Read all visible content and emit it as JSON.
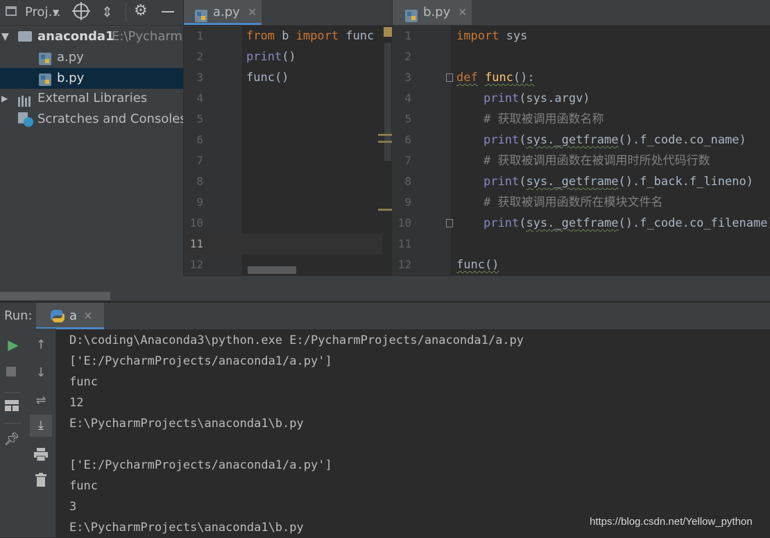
{
  "project_panel": {
    "title": "Proj…",
    "toolbar_icons": [
      "crosshair-icon",
      "collapse-icon",
      "gear-icon",
      "minimize-icon"
    ],
    "root": {
      "name": "anaconda1",
      "path": "E:\\PycharmP"
    },
    "files": [
      {
        "label": "a.py",
        "selected": false
      },
      {
        "label": "b.py",
        "selected": true
      }
    ],
    "external_libraries": "External Libraries",
    "scratches": "Scratches and Consoles"
  },
  "left_editor": {
    "tab": "a.py",
    "line_numbers": [
      "1",
      "2",
      "3",
      "4",
      "5",
      "6",
      "7",
      "8",
      "9",
      "10",
      "11",
      "12"
    ]
  },
  "right_editor": {
    "tab": "b.py",
    "line_numbers": [
      "1",
      "2",
      "3",
      "4",
      "5",
      "6",
      "7",
      "8",
      "9",
      "10",
      "11",
      "12"
    ]
  },
  "run": {
    "label": "Run:",
    "tab": "a",
    "output": [
      "D:\\coding\\Anaconda3\\python.exe E:/PycharmProjects/anaconda1/a.py",
      "['E:/PycharmProjects/anaconda1/a.py']",
      "func",
      "12",
      "E:\\PycharmProjects\\anaconda1\\b.py",
      "",
      "['E:/PycharmProjects/anaconda1/a.py']",
      "func",
      "3",
      "E:\\PycharmProjects\\anaconda1\\b.py"
    ]
  },
  "watermark": "https://blog.csdn.net/Yellow_python",
  "colors": {
    "keyword": "#cc7832",
    "function": "#ffc66d",
    "builtin": "#8888c6",
    "comment": "#808080",
    "text": "#a9b7c6"
  }
}
